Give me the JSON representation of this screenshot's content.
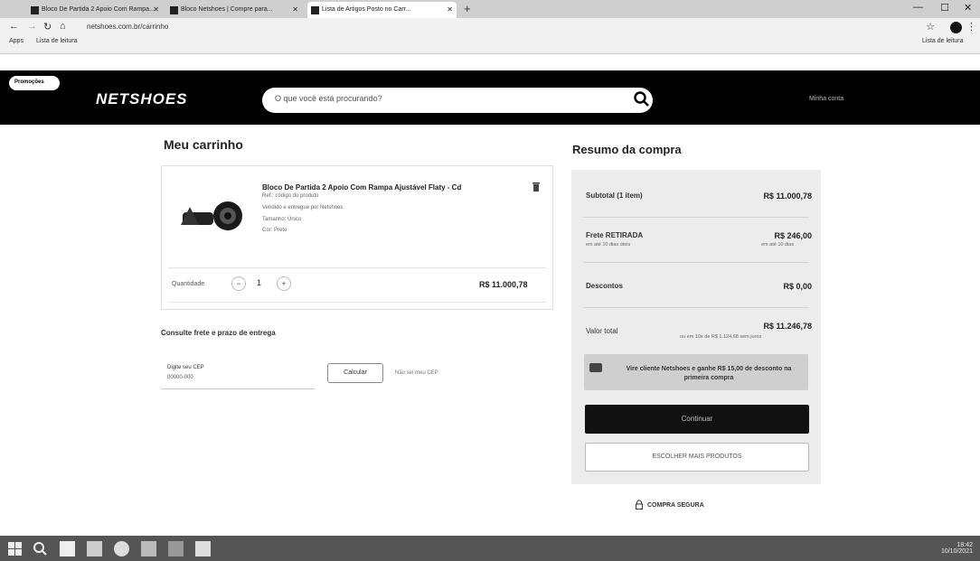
{
  "browser": {
    "tabs": [
      {
        "label": "Bloco De Partida 2 Apoio Com Rampa..."
      },
      {
        "label": "Bloco Netshoes | Compre para...",
        "active": false
      },
      {
        "label": "Lista de Artigos Posto no Carr...",
        "active": true
      }
    ],
    "url": "netshoes.com.br/carrinho",
    "bookmarks": [
      "Apps",
      "Lista de leitura"
    ],
    "reading_list": "Lista de leitura"
  },
  "header": {
    "promo_pill": "Promoções",
    "logo": "NETSHOES",
    "search_placeholder": "O que você está procurando?",
    "account": "Minha conta"
  },
  "cart": {
    "title": "Meu carrinho",
    "product_name": "Bloco De Partida 2 Apoio Com Rampa Ajustável Flaty - Cd",
    "lines": [
      "Ref.: código do produto",
      "Vendido e entregue por Netshoes",
      "Tamanho: Único",
      "Cor: Preto"
    ],
    "qty_label": "Quantidade",
    "qty_value": "1",
    "qty_minus": "−",
    "qty_plus": "+",
    "price": "R$ 11.000,78",
    "shipping_title": "Consulte frete e prazo de entrega",
    "cep_label": "Digite seu CEP",
    "cep_value": "00000-000",
    "calc_button": "Calcular",
    "cep_link": "Não sei meu CEP"
  },
  "summary": {
    "title": "Resumo da compra",
    "subtotal_label": "Subtotal (1 item)",
    "subtotal_value": "R$ 11.000,78",
    "freight_label": "Frete RETIRADA",
    "freight_value": "R$ 246,00",
    "freight_sub": "em até 10 dias úteis",
    "freight_sub2": "em até 10 dias",
    "discount_label": "Descontos",
    "discount_value": "R$ 0,00",
    "total_label": "Valor total",
    "total_value": "R$ 11.246,78",
    "total_sub": "ou em 10x de R$ 1.124,68 sem juros",
    "promo": "Vire cliente Netshoes e ganhe R$ 15,00 de desconto na primeira compra",
    "continue_button": "Continuar",
    "more_button": "ESCOLHER MAIS PRODUTOS",
    "secure": "COMPRA SEGURA"
  },
  "taskbar": {
    "time": "18:42",
    "date": "10/10/2021"
  }
}
